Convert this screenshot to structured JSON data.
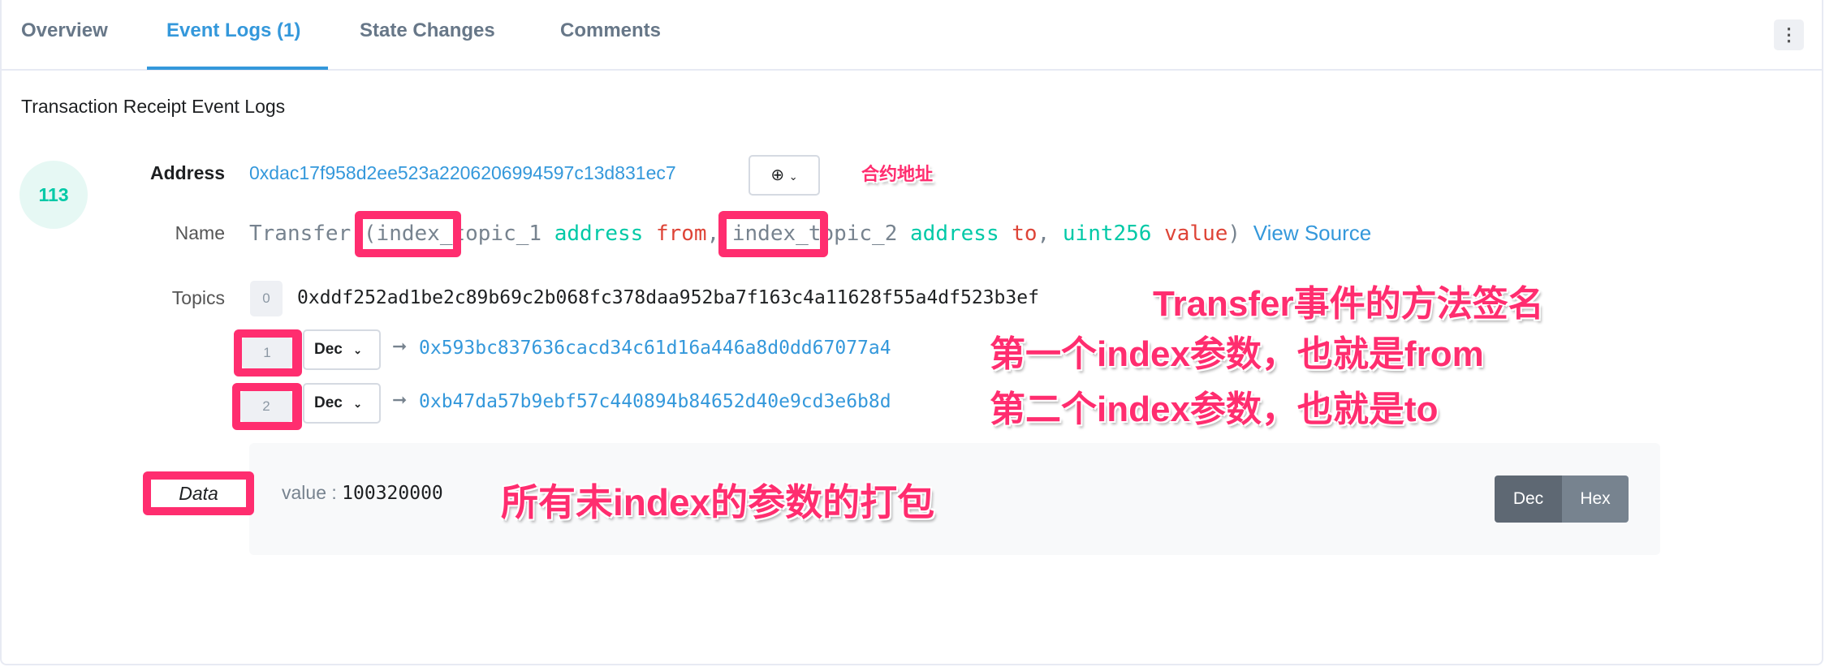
{
  "tabs": [
    {
      "label": "Overview"
    },
    {
      "label": "Event Logs (1)"
    },
    {
      "label": "State Changes"
    },
    {
      "label": "Comments"
    }
  ],
  "kebab_icon": "more-vertical-icon",
  "section_title": "Transaction Receipt Event Logs",
  "log": {
    "index": "113",
    "address_label": "Address",
    "address": "0xdac17f958d2ee523a2206206994597c13d831ec7",
    "name_label": "Name",
    "name": {
      "event": "Transfer",
      "open": "(",
      "p1_idx": "index_topic_1",
      "p1_type": "address",
      "p1_name": "from",
      "sep": ",",
      "p2_idx": "index_topic_2",
      "p2_type": "address",
      "p2_name": "to",
      "sep2": ",",
      "p3_type": "uint256",
      "p3_name": "value",
      "close": ")",
      "view_source": "View Source"
    },
    "topics_label": "Topics",
    "topics": [
      {
        "index": "0",
        "value": "0xddf252ad1be2c89b69c2b068fc378daa952ba7f163c4a11628f55a4df523b3ef"
      },
      {
        "index": "1",
        "format": "Dec",
        "value": "0x593bc837636cacd34c61d16a446a8d0dd67077a4"
      },
      {
        "index": "2",
        "format": "Dec",
        "value": "0xb47da57b9ebf57c440894b84652d40e9cd3e6b8d"
      }
    ],
    "data_label": "Data",
    "data_key": "value :",
    "data_value": "100320000",
    "toggle": {
      "dec": "Dec",
      "hex": "Hex"
    }
  },
  "annotations": {
    "address": "合约地址",
    "topic0": "Transfer事件的方法签名",
    "topic1": "第一个index参数，也就是from",
    "topic2": "第二个index参数，也就是to",
    "data": "所有未index的参数的打包"
  }
}
